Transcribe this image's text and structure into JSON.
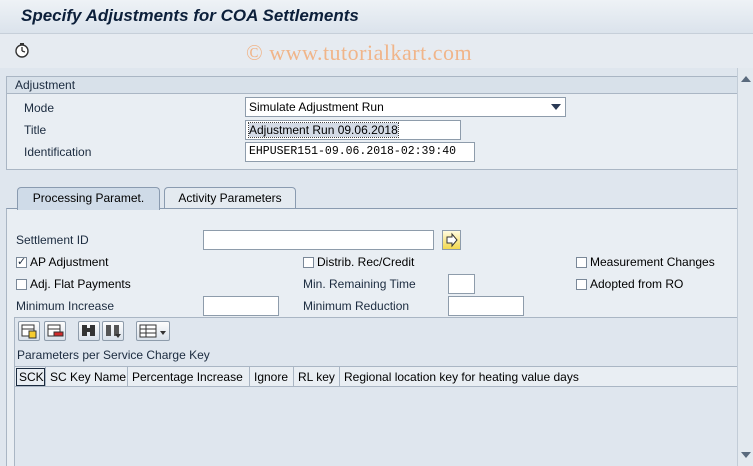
{
  "window": {
    "title": "Specify Adjustments for COA Settlements"
  },
  "watermark": "© www.tutorialkart.com",
  "adjustment": {
    "group_title": "Adjustment",
    "mode_label": "Mode",
    "mode_value": "Simulate Adjustment Run",
    "title_label": "Title",
    "title_value": "Adjustment Run 09.06.2018",
    "identification_label": "Identification",
    "identification_value": "EHPUSER151-09.06.2018-02:39:40"
  },
  "tabs": [
    {
      "label": "Processing Paramet.",
      "active": true
    },
    {
      "label": "Activity Parameters",
      "active": false
    }
  ],
  "processing": {
    "settlement_id_label": "Settlement ID",
    "settlement_id_value": "",
    "ap_adjustment": {
      "label": "AP Adjustment",
      "checked": true
    },
    "distrib_rec_credit": {
      "label": "Distrib. Rec/Credit",
      "checked": false
    },
    "measurement_changes": {
      "label": "Measurement Changes",
      "checked": false
    },
    "adj_flat_payments": {
      "label": "Adj. Flat Payments",
      "checked": false
    },
    "min_remaining_time_label": "Min. Remaining Time",
    "min_remaining_time_value": "",
    "adopted_from_ro": {
      "label": "Adopted from RO",
      "checked": false
    },
    "minimum_increase_label": "Minimum Increase",
    "minimum_increase_value": "",
    "minimum_reduction_label": "Minimum Reduction",
    "minimum_reduction_value": ""
  },
  "table": {
    "title": "Parameters per Service Charge Key",
    "columns": [
      "SCK",
      "SC Key Name",
      "Percentage Increase",
      "Ignore",
      "RL key",
      "Regional location key for heating value days"
    ],
    "rows": []
  },
  "icons": {
    "execute": "execute-clock-icon",
    "settlement_search": "arrow-right-icon",
    "table_tools": [
      "insert-row-icon",
      "delete-row-icon",
      "find-icon",
      "find-next-icon",
      "column-config-icon"
    ]
  },
  "colors": {
    "watermark": "#f0b58a",
    "title": "#0c1f3a",
    "background": "#dfe6ee"
  }
}
